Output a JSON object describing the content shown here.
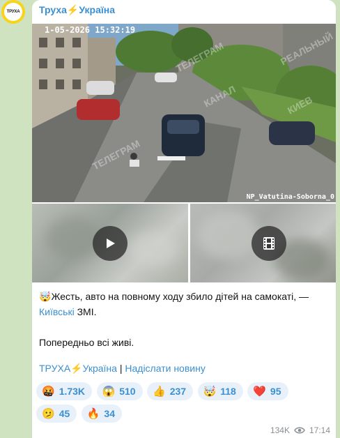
{
  "channel": {
    "name": "Труха⚡Україна",
    "avatar_text": "ТРУХА"
  },
  "media": {
    "camera_timestamp": "1-05-2026 15:32:19",
    "camera_label": "NP_Vatutina-Soborna_0",
    "watermark": "ТЕЛЕГРАМ КАНАЛ РЕАЛЬНЫЙ КИЕВ",
    "thumb1_icon": "play-icon",
    "thumb2_icon": "film-icon"
  },
  "post": {
    "line1_emoji": "🤯",
    "line1_text": "Жесть, авто на повному ходу збило дітей на самокаті, —",
    "line2_link": "Київські",
    "line2_text": " ЗМІ.",
    "line3": "Попередньо всі живі."
  },
  "signature": {
    "channel_link": "ТРУХА⚡Україна",
    "separator": " | ",
    "submit_link": "Надіслати новину"
  },
  "reactions": [
    {
      "emoji": "🤬",
      "count": "1.73K"
    },
    {
      "emoji": "😱",
      "count": "510"
    },
    {
      "emoji": "👍",
      "count": "237"
    },
    {
      "emoji": "🤯",
      "count": "118"
    },
    {
      "emoji": "❤️",
      "count": "95"
    },
    {
      "emoji": "🫤",
      "count": "45"
    },
    {
      "emoji": "🔥",
      "count": "34"
    }
  ],
  "meta": {
    "views": "134K",
    "time": "17:14"
  },
  "colors": {
    "accent": "#3a8fd0",
    "background": "#cfe3c0",
    "avatar_ring": "#f7d31a"
  }
}
